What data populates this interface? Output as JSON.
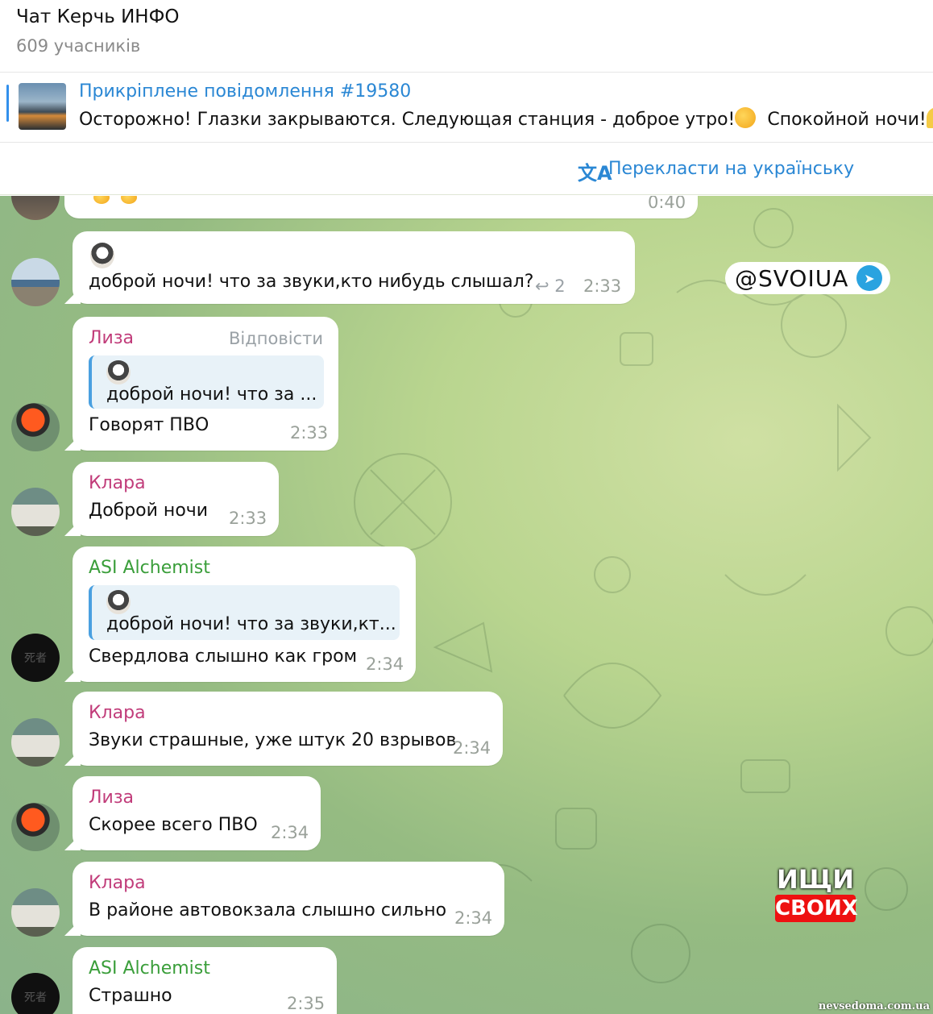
{
  "header": {
    "title": "Чат Керчь ИНФО",
    "members": "609 учасників"
  },
  "pinned": {
    "title": "Прикріплене повідомлення #19580",
    "text": "Осторожно! Глазки закрываются. Следующая станция - доброе утро!",
    "text_tail": "Спокойной ночи!"
  },
  "translate": {
    "label": "Перекласти на українську"
  },
  "messages": [
    {
      "time": "0:40"
    },
    {
      "text": "доброй ночи! что за звуки,кто нибудь слышал?",
      "replies": "2",
      "time": "2:33"
    },
    {
      "sender": "Лиза",
      "reply_label": "Відповісти",
      "quote": "доброй ночи! что за ...",
      "text": "Говорят ПВО",
      "time": "2:33"
    },
    {
      "sender": "Клара",
      "text": "Доброй ночи",
      "time": "2:33"
    },
    {
      "sender": "ASI Alchemist",
      "quote": "доброй ночи! что за звуки,кт...",
      "text": "Свердлова слышно как гром",
      "time": "2:34"
    },
    {
      "sender": "Клара",
      "text": "Звуки страшные, уже штук 20 взрывов",
      "time": "2:34"
    },
    {
      "sender": "Лиза",
      "text": "Скорее всего ПВО",
      "time": "2:34"
    },
    {
      "sender": "Клара",
      "text": "В районе автовокзала слышно сильно",
      "time": "2:34"
    },
    {
      "sender": "ASI Alchemist",
      "text": "Страшно",
      "time": "2:35"
    }
  ],
  "watermarks": {
    "svoiua": "@SVOIUA",
    "ishchi_top": "ИЩИ",
    "ishchi_bottom": "СВОИХ",
    "site": "nevsedoma.com.ua"
  },
  "colors": {
    "accent": "#2a87d4",
    "sender_pink": "#c13c7a",
    "sender_green": "#3a9e3a"
  }
}
